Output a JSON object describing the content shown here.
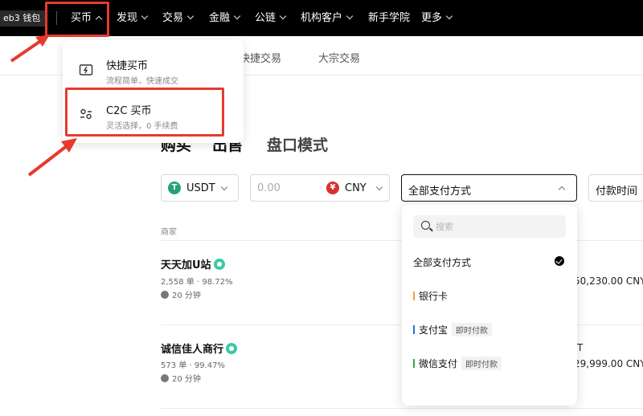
{
  "colors": {
    "annotation": "#e63a2e",
    "usdt": "#26a17b",
    "cny": "#d9302c",
    "verified": "#3cc8a6"
  },
  "topnav": {
    "wallet": "eb3 钱包",
    "items": [
      "买币",
      "发现",
      "交易",
      "金融",
      "公链",
      "机构客户",
      "新手学院",
      "更多"
    ]
  },
  "subtabs": [
    "快捷交易",
    "大宗交易"
  ],
  "buy_menu": {
    "items": [
      {
        "title": "快捷买币",
        "subtitle": "流程简单，快速成交",
        "icon": "quick-buy-icon"
      },
      {
        "title": "C2C 买币",
        "subtitle": "灵活选择，0 手续费",
        "icon": "c2c-icon"
      }
    ]
  },
  "mode_tabs": [
    "购买",
    "出售",
    "盘口模式"
  ],
  "filters": {
    "coin": "USDT",
    "amount_placeholder": "0.00",
    "currency": "CNY",
    "payment": "全部支付方式",
    "sort": "付款时间"
  },
  "list": {
    "header": "商家",
    "rows": [
      {
        "name": "天天加U站",
        "stats": "2,558 单 · 98.72%",
        "time": "20 分钟",
        "limit": "50,230.00 CNY"
      },
      {
        "name": "诚信佳人商行",
        "stats": "573 单 · 99.47%",
        "time": "20 分钟",
        "unit": "T",
        "limit": "29,999.00 CNY"
      }
    ]
  },
  "payment_dropdown": {
    "search_placeholder": "搜索",
    "options": [
      {
        "label": "全部支付方式",
        "tag": "",
        "selected": true,
        "color": ""
      },
      {
        "label": "银行卡",
        "tag": "",
        "selected": false,
        "color": "#f0a23b"
      },
      {
        "label": "支付宝",
        "tag": "即时付款",
        "selected": false,
        "color": "#2f6fe0"
      },
      {
        "label": "微信支付",
        "tag": "即时付款",
        "selected": false,
        "color": "#2aa84a"
      }
    ]
  }
}
